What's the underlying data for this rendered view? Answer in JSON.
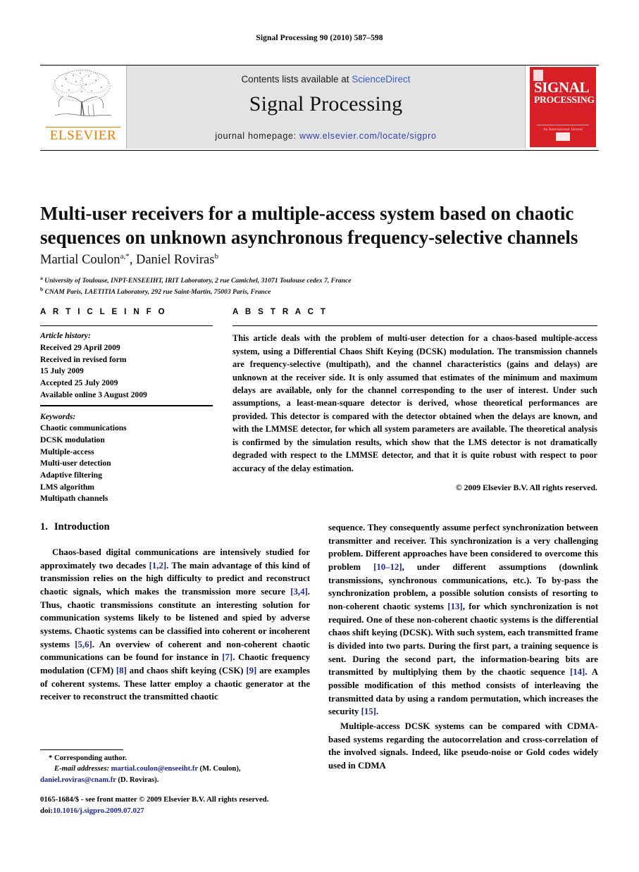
{
  "running_head": "Signal Processing 90 (2010) 587–598",
  "masthead": {
    "publisher_logo_word": "ELSEVIER",
    "contents_prefix": "Contents lists available at ",
    "contents_link": "ScienceDirect",
    "journal_name": "Signal Processing",
    "homepage_prefix": "journal homepage: ",
    "homepage_url": "www.elsevier.com/locate/sigpro",
    "cover": {
      "line1": "SIGNAL",
      "line2": "PROCESSING",
      "subtitle": "An International Journal"
    },
    "colors": {
      "link_blue": "#3b5ec4",
      "url_blue": "#2f3fa8",
      "elsevier_orange": "#ef7d00",
      "cover_red": "#d81f26",
      "band_gray": "#e3e3e3"
    }
  },
  "article": {
    "title": "Multi-user receivers for a multiple-access system based on chaotic sequences on unknown asynchronous frequency-selective channels",
    "authors_1": "Martial Coulon",
    "authors_1_sup": "a,*",
    "authors_sep": ", ",
    "authors_2": "Daniel Roviras",
    "authors_2_sup": "b",
    "affiliation_a_mark": "a",
    "affiliation_a": "University of Toulouse, INPT-ENSEEIHT, IRIT Laboratory, 2 rue Camichel, 31071 Toulouse cedex 7, France",
    "affiliation_b_mark": "b",
    "affiliation_b": "CNAM Paris, LAETITIA Laboratory, 292 rue Saint-Martin, 75003 Paris, France"
  },
  "article_info": {
    "heading": "A R T I C L E    I N F O",
    "history_label": "Article history:",
    "history": [
      "Received 29 April 2009",
      "Received in revised form",
      "15 July 2009",
      "Accepted 25 July 2009",
      "Available online 3 August 2009"
    ],
    "keywords_label": "Keywords:",
    "keywords": [
      "Chaotic communications",
      "DCSK modulation",
      "Multiple-access",
      "Multi-user detection",
      "Adaptive filtering",
      "LMS algorithm",
      "Multipath channels"
    ]
  },
  "abstract": {
    "heading": "A B S T R A C T",
    "text": "This article deals with the problem of multi-user detection for a chaos-based multiple-access system, using a Differential Chaos Shift Keying (DCSK) modulation. The transmission channels are frequency-selective (multipath), and the channel characteristics (gains and delays) are unknown at the receiver side. It is only assumed that estimates of the minimum and maximum delays are available, only for the channel corresponding to the user of interest. Under such assumptions, a least-mean-square detector is derived, whose theoretical performances are provided. This detector is compared with the detector obtained when the delays are known, and with the LMMSE detector, for which all system parameters are available. The theoretical analysis is confirmed by the simulation results, which show that the LMS detector is not dramatically degraded with respect to the LMMSE detector, and that it is quite robust with respect to poor accuracy of the delay estimation.",
    "copyright": "© 2009 Elsevier B.V. All rights reserved."
  },
  "body": {
    "section_number": "1.",
    "section_title": "Introduction",
    "left_paragraph_parts": [
      "Chaos-based digital communications are intensively studied for approximately two decades ",
      "[1,2]",
      ". The main advantage of this kind of transmission relies on the high difficulty to predict and reconstruct chaotic signals, which makes the transmission more secure ",
      "[3,4]",
      ". Thus, chaotic transmissions constitute an interesting solution for communication systems likely to be listened and spied by adverse systems. Chaotic systems can be classified into coherent or incoherent systems ",
      "[5,6]",
      ". An overview of coherent and non-coherent chaotic communications can be found for instance in ",
      "[7]",
      ". Chaotic frequency modulation (CFM) ",
      "[8]",
      " and chaos shift keying (CSK) ",
      "[9]",
      " are examples of coherent systems. These latter employ a chaotic generator at the receiver to reconstruct the transmitted chaotic"
    ],
    "right_paragraph1_parts": [
      "sequence. They consequently assume perfect synchronization between transmitter and receiver. This synchronization is a very challenging problem. Different approaches have been considered to overcome this problem ",
      "[10–12]",
      ", under different assumptions (downlink transmissions, synchronous communications, etc.). To by-pass the synchronization problem, a possible solution consists of resorting to non-coherent chaotic systems ",
      "[13]",
      ", for which synchronization is not required. One of these non-coherent chaotic systems is the differential chaos shift keying (DCSK). With such system, each transmitted frame is divided into two parts. During the first part, a training sequence is sent. During the second part, the information-bearing bits are transmitted by multiplying them by the chaotic sequence ",
      "[14]",
      ". A possible modification of this method consists of interleaving the transmitted data by using a random permutation, which increases the security ",
      "[15]",
      "."
    ],
    "right_paragraph2": "Multiple-access DCSK systems can be compared with CDMA-based systems regarding the autocorrelation and cross-correlation of the involved signals. Indeed, like pseudo-noise or Gold codes widely used in CDMA"
  },
  "footnote": {
    "corresponding_mark": "*",
    "corresponding_text": "Corresponding author.",
    "email_label": "E-mail addresses:",
    "email_1": "martial.coulon@enseeiht.fr",
    "email_1_owner": " (M. Coulon),",
    "email_2": "daniel.roviras@cnam.fr",
    "email_2_owner": " (D. Roviras)."
  },
  "colophon": {
    "line1": "0165-1684/$ - see front matter © 2009 Elsevier B.V. All rights reserved.",
    "doi_label": "doi:",
    "doi_value": "10.1016/j.sigpro.2009.07.027"
  }
}
